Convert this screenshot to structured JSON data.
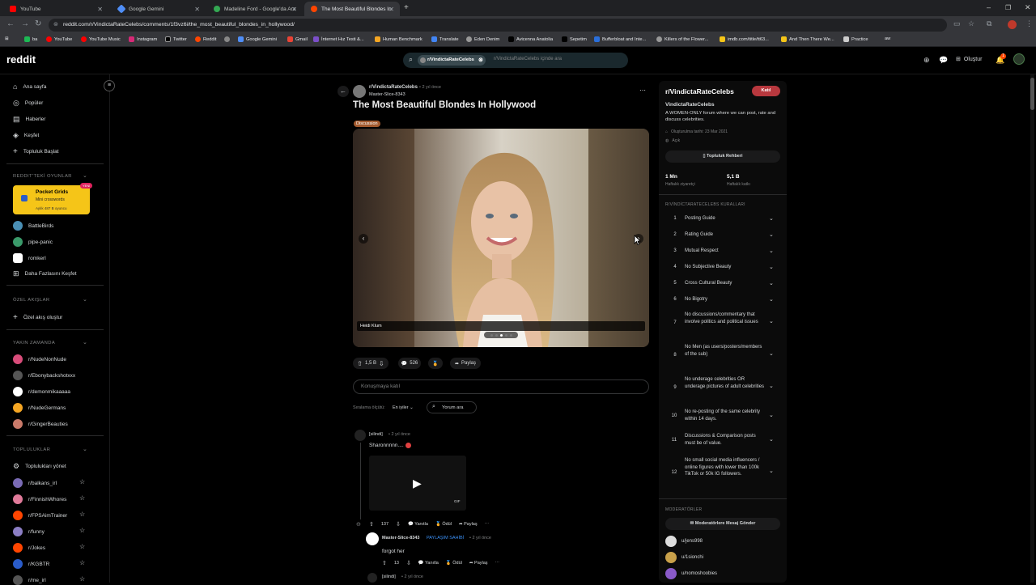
{
  "browser": {
    "tabs": [
      {
        "title": "YouTube",
        "color": "#ff0000"
      },
      {
        "title": "Google Gemini",
        "color": "#4f8ef7"
      },
      {
        "title": "Madeline Ford - Google'da Ara",
        "color": "#34a853"
      },
      {
        "title": "The Most Beautiful Blondes In H",
        "color": "#ff4500"
      }
    ],
    "url": "reddit.com/r/VindictaRateCelebs/comments/1f3vz6i/the_most_beautiful_blondes_in_hollywood/",
    "bookmarks": [
      "ba",
      "YouTube",
      "YouTube Music",
      "Instagram",
      "Twitter",
      "Reddit",
      "Google Gemini",
      "Gmail",
      "İnternet Hız Testi &...",
      "Human Benchmark",
      "Translate",
      "Eden Denim",
      "Avicenna Anatolia",
      "Sepetim",
      "Bufferbloat and Inte...",
      "Killers of the Flower...",
      "imdb.com/title/tt63...",
      "And Then There We...",
      "Practice",
      "aw"
    ]
  },
  "reddit": {
    "logo": "reddit",
    "search_chip": "r/VindictaRateCelebs",
    "search_placeholder": "r/VindictaRateCelebs içinde ara",
    "create": "Oluştur",
    "notif_count": "1"
  },
  "sidebar": {
    "nav": [
      "Ana sayfa",
      "Popüler",
      "Haberler",
      "Keşfet",
      "Topluluk Başlat"
    ],
    "games_header": "REDDIT'TEKİ OYUNLAR",
    "promo": {
      "title": "Pocket Grids",
      "sub": "Mini crosswords",
      "meta": "Aylık 487 B oyuncu",
      "badge": "YENİ"
    },
    "games": [
      "BattleBirds",
      "pipe-panic",
      "romkerl",
      "Daha Fazlasını Keşfet"
    ],
    "feeds_header": "ÖZEL AKIŞLAR",
    "feeds_item": "Özel akış oluştur",
    "recent_header": "YAKIN ZAMANDA",
    "recent": [
      {
        "name": "r/NudeNonNude",
        "color": "#d84c7a"
      },
      {
        "name": "r/Ebonybackshotxxx",
        "color": "#555"
      },
      {
        "name": "r/demonmikaaaaa",
        "color": "#ffffff"
      },
      {
        "name": "r/NudeGermans",
        "color": "#f5a623"
      },
      {
        "name": "r/GingerBeauties",
        "color": "#c97a6a"
      }
    ],
    "communities_header": "TOPLULUKLAR",
    "manage": "Toplulukları yönet",
    "communities": [
      {
        "name": "r/balkans_irl",
        "color": "#7a6bb5"
      },
      {
        "name": "r/FinnishWhores",
        "color": "#e07a9a"
      },
      {
        "name": "r/FPSAimTrainer",
        "color": "#ff4500"
      },
      {
        "name": "r/funny",
        "color": "#8c7ec4"
      },
      {
        "name": "r/Jokes",
        "color": "#ff4500"
      },
      {
        "name": "r/KGBTR",
        "color": "#2a5cc9"
      },
      {
        "name": "r/me_irl",
        "color": "#555"
      }
    ]
  },
  "post": {
    "subreddit": "r/VindictaRateCelebs",
    "time": "• 2 yıl önce",
    "author": "Master-Slice-8343",
    "title": "The Most Beautiful Blondes In Hollywood",
    "flair": "Discussion",
    "caption": "Heidi Klum",
    "votes": "1,5 B",
    "comments": "526",
    "share": "Paylaş",
    "comment_placeholder": "Konuşmaya katıl",
    "sort_label": "Sıralama ölçütü:",
    "sort_value": "En iyiler",
    "search_comments": "Yorum ara",
    "gallery_index": 3,
    "gallery_total": 5
  },
  "comments": [
    {
      "author": "[silindi]",
      "time": "• 2 yıl önce",
      "text": "Sharonnnnn....",
      "votes": "137",
      "reply": "Yanıtla",
      "award": "Ödül",
      "share": "Paylaş",
      "gif": "GIF"
    },
    {
      "author": "Master-Slice-8343",
      "op": "PAYLAŞIM SAHİBİ",
      "time": "• 2 yıl önce",
      "text": "forgot her",
      "votes": "13",
      "reply": "Yanıtla",
      "award": "Ödül",
      "share": "Paylaş"
    },
    {
      "author": "[silindi]",
      "time": "• 2 yıl önce"
    }
  ],
  "community": {
    "name": "r/VindictaRateCelebs",
    "join": "Katıl",
    "title": "VindictaRateCelebs",
    "desc": "A WOMEN-ONLY forum where we can post, rate and discuss celebrities.",
    "created": "Oluşturulma tarihi: 23 Mar 2021",
    "visibility": "Açık",
    "guide": "Topluluk Rehberi",
    "stat1_val": "1 Mn",
    "stat1_label": "Haftalık ziyaretçi",
    "stat2_val": "5,1 B",
    "stat2_label": "Haftalık katkı",
    "rules_header": "R/VİNDİCTARATECELEBS KURALLARI",
    "rules": [
      "Posting Guide",
      "Rating Guide",
      "Mutual Respect",
      "No Subjective Beauty",
      "Cross Cultural Beauty",
      "No Bigotry",
      "No discussions/commentary that involve politics and political issues",
      "No Men (as users/posters/members of the sub)",
      "No underage celebrities OR underage pictures of adult celebrities",
      "No re-posting of the same celebrity within 14 days.",
      "Discussions & Comparison posts must be of value.",
      "No small social media influencers / online figures with lower than 100k TikTok or 50k IG followers."
    ],
    "mods_header": "MODERATÖRLER",
    "mods_button": "Moderatörlere Mesaj Gönder",
    "mods": [
      "u/jens998",
      "u/1sionchi",
      "u/nomoshoobies"
    ]
  }
}
